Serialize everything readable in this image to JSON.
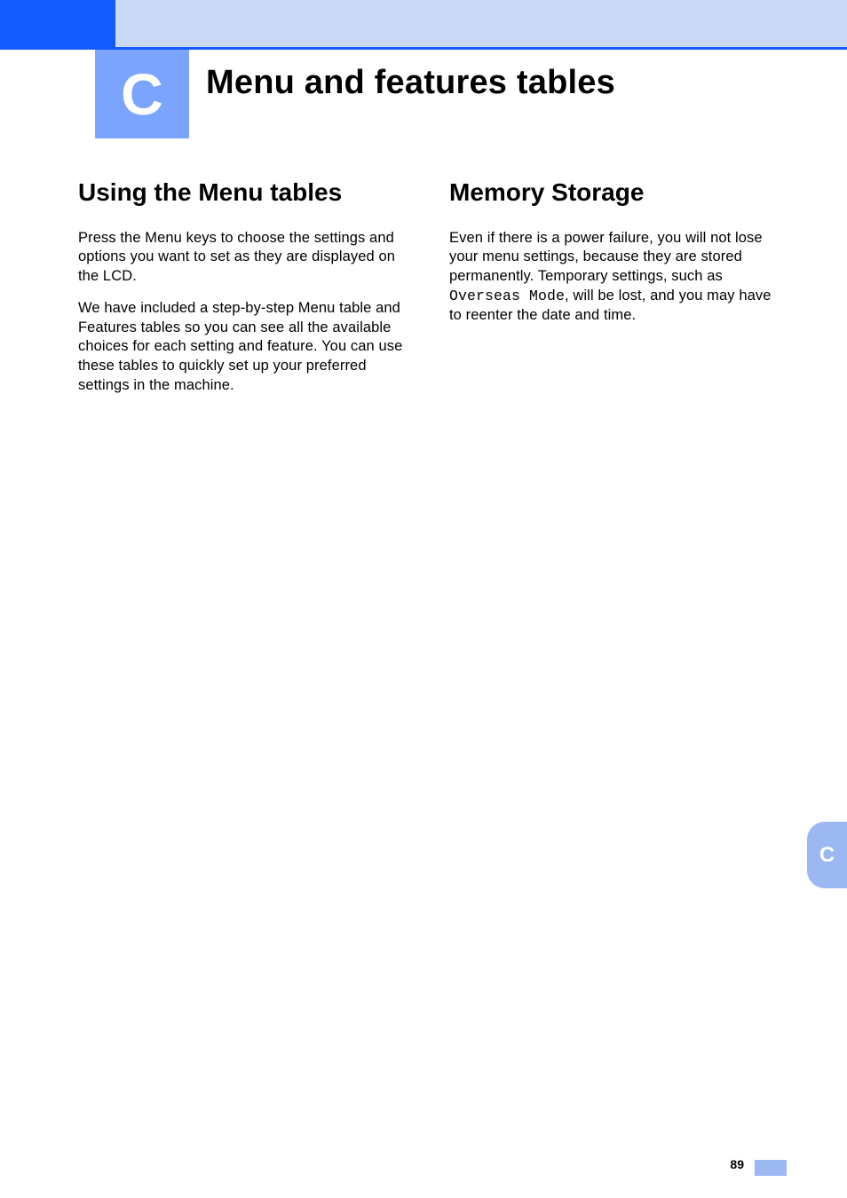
{
  "chapter": {
    "letter": "C",
    "title": "Menu and features tables"
  },
  "columns": {
    "left": {
      "heading": "Using the Menu tables",
      "p1": "Press the Menu keys to choose the settings and options you want to set as they are displayed on the LCD.",
      "p2": "We have included a step-by-step Menu table and Features tables so you can see all the available choices for each setting and feature. You can use these tables to quickly set up your preferred settings in the machine."
    },
    "right": {
      "heading": "Memory Storage",
      "p1_pre": "Even if there is a power failure, you will not lose your menu settings, because they are stored permanently. Temporary settings, such as ",
      "p1_code": "Overseas Mode",
      "p1_post": ", will be lost, and you may have to reenter the date and time."
    }
  },
  "edgeTab": "C",
  "pageNumber": "89"
}
